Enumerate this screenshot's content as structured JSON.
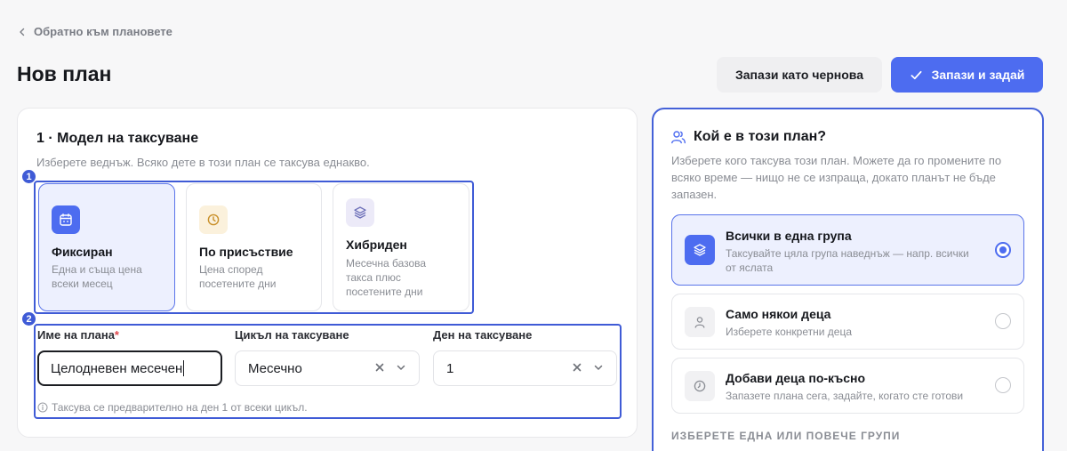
{
  "nav": {
    "back_label": "Обратно към плановете"
  },
  "page": {
    "title": "Нов план"
  },
  "actions": {
    "draft_label": "Запази като чернова",
    "save_label": "Запази и задай"
  },
  "pricing": {
    "section_title": "1 · Модел на таксуване",
    "section_subtitle": "Изберете веднъж. Всяко дете в този план се таксува еднакво.",
    "highlight_badges": [
      "1",
      "2"
    ],
    "options": [
      {
        "name": "Фиксиран",
        "desc": "Една и съща цена всеки месец",
        "icon": "calendar-icon",
        "selected": true
      },
      {
        "name": "По присъствие",
        "desc": "Цена според посетените дни",
        "icon": "clock-dollar-icon",
        "selected": false
      },
      {
        "name": "Хибриден",
        "desc": "Месечна базова такса плюс посетените дни",
        "icon": "layers-icon",
        "selected": false
      }
    ],
    "fields": {
      "plan_name": {
        "label": "Име на плана",
        "required_mark": "*",
        "value": "Целодневен месечен"
      },
      "billing_cycle": {
        "label": "Цикъл на таксуване",
        "value": "Месечно"
      },
      "billing_day": {
        "label": "Ден на таксуване",
        "value": "1"
      }
    },
    "hint": "Таксува се предварително на ден 1 от всеки цикъл."
  },
  "audience": {
    "title": "Кой е в този план?",
    "subtitle": "Изберете кого таксува този план. Можете да го промените по всяко време — нищо не се изпраща, докато планът не бъде запазен.",
    "options": [
      {
        "name": "Всички в една група",
        "desc": "Таксувайте цяла група наведнъж — напр. всички от яслата",
        "icon": "layers-icon",
        "selected": true
      },
      {
        "name": "Само някои деца",
        "desc": "Изберете конкретни деца",
        "icon": "person-icon",
        "selected": false
      },
      {
        "name": "Добави деца по-късно",
        "desc": "Запазете плана сега, задайте, когато сте готови",
        "icon": "clock-icon",
        "selected": false
      }
    ],
    "groups_heading": "ИЗБЕРЕТЕ ЕДНА ИЛИ ПОВЕЧЕ ГРУПИ"
  },
  "colors": {
    "accent": "#4d6cf0",
    "highlight": "#3f5bd6",
    "selected_bg": "#edf0fe"
  }
}
